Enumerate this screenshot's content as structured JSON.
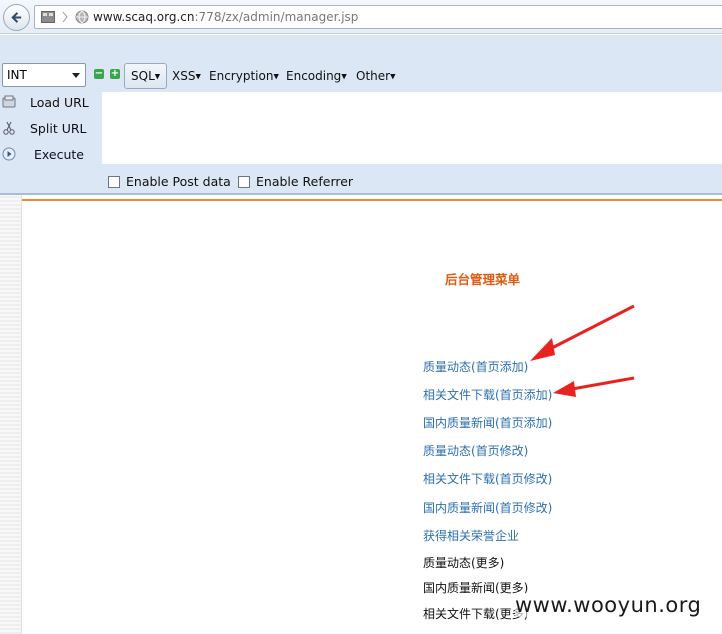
{
  "browser": {
    "url_host": "www.scaq.org.cn",
    "url_path": ":778/zx/admin/manager.jsp"
  },
  "hackbar": {
    "select_value": "INT",
    "menus": {
      "sql": "SQL",
      "xss": "XSS",
      "encryption": "Encryption",
      "encoding": "Encoding",
      "other": "Other"
    },
    "load_url": "Load URL",
    "split_url": "Split URL",
    "execute": "Execute",
    "enable_post": "Enable Post data",
    "enable_referrer": "Enable Referrer",
    "post_checked": false,
    "referrer_checked": false
  },
  "page": {
    "title": "后台管理菜单",
    "links": [
      {
        "label": "质量动态(首页添加)",
        "clickable": true
      },
      {
        "label": "相关文件下载(首页添加)",
        "clickable": true
      },
      {
        "label": "国内质量新闻(首页添加)",
        "clickable": true
      },
      {
        "label": "质量动态(首页修改)",
        "clickable": true
      },
      {
        "label": "相关文件下载(首页修改)",
        "clickable": true
      },
      {
        "label": "国内质量新闻(首页修改)",
        "clickable": true
      },
      {
        "label": "获得相关荣誉企业",
        "clickable": true
      },
      {
        "label": "质量动态(更多)",
        "clickable": true
      },
      {
        "label": "国内质量新闻(更多)",
        "clickable": true
      },
      {
        "label": "相关文件下载(更多)",
        "clickable": true
      }
    ]
  },
  "watermark": "www.wooyun.org",
  "colors": {
    "accent_orange": "#ef8a2e",
    "title_orange": "#e05a10",
    "link_blue": "#2f6fae",
    "arrow_red": "#e8231f",
    "hackbar_bg": "#dbe7f4"
  }
}
